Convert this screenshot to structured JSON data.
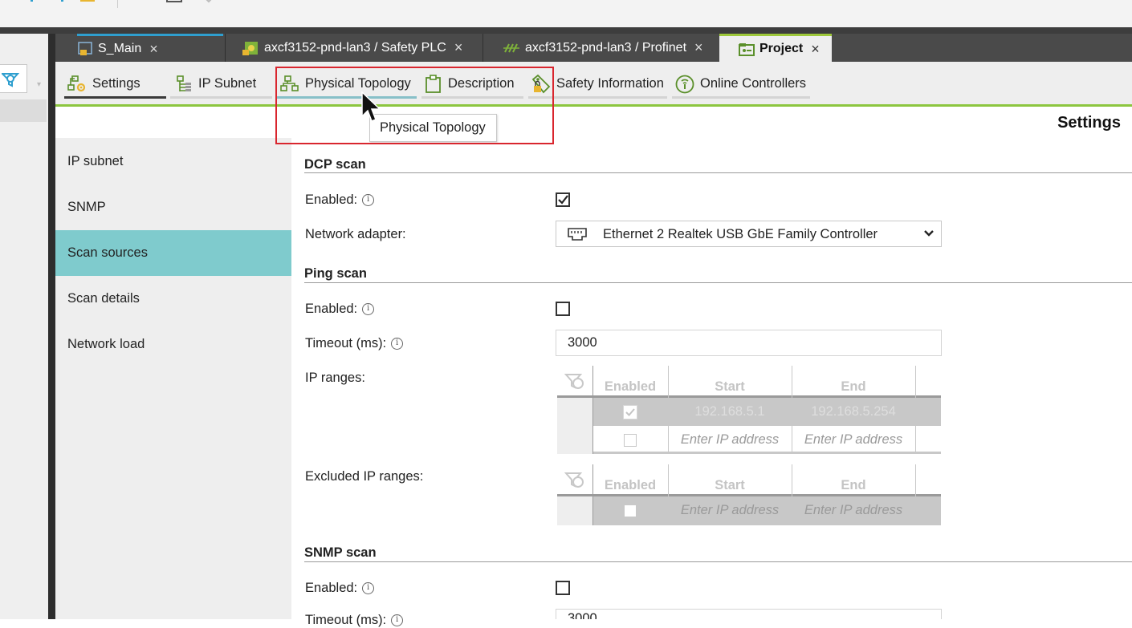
{
  "editor_tabs": [
    {
      "label": "S_Main",
      "close": "×"
    },
    {
      "label": "axcf3152-pnd-lan3 / Safety PLC",
      "close": "×"
    },
    {
      "label": "axcf3152-pnd-lan3 / Profinet",
      "close": "×"
    },
    {
      "label": "Project",
      "close": "×",
      "active": true
    }
  ],
  "sub_tabs": [
    {
      "label": "Settings",
      "active": true
    },
    {
      "label": "IP Subnet"
    },
    {
      "label": "Physical Topology",
      "hover": true
    },
    {
      "label": "Description"
    },
    {
      "label": "Safety Information"
    },
    {
      "label": "Online Controllers"
    }
  ],
  "tooltip": "Physical Topology",
  "page_title": "Settings",
  "nav": [
    {
      "label": "IP subnet"
    },
    {
      "label": "SNMP"
    },
    {
      "label": "Scan sources",
      "selected": true
    },
    {
      "label": "Scan details"
    },
    {
      "label": "Network load"
    }
  ],
  "dcp": {
    "title": "DCP scan",
    "enabled_label": "Enabled:",
    "enabled": true,
    "adapter_label": "Network adapter:",
    "adapter_value": "Ethernet 2 Realtek USB GbE Family Controller"
  },
  "ping": {
    "title": "Ping scan",
    "enabled_label": "Enabled:",
    "enabled": false,
    "timeout_label": "Timeout (ms):",
    "timeout_value": "3000",
    "ip_ranges_label": "IP ranges:",
    "excluded_label": "Excluded IP ranges:",
    "table_headers": [
      "Enabled",
      "Start",
      "End"
    ],
    "ip_ranges": [
      {
        "enabled": true,
        "start": "192.168.5.1",
        "end": "192.168.5.254",
        "selected": true
      },
      {
        "enabled": false,
        "start": "Enter IP address",
        "end": "Enter IP address",
        "placeholder": true
      }
    ],
    "excluded_ranges": [
      {
        "enabled": false,
        "start": "Enter IP address",
        "end": "Enter IP address",
        "placeholder": true,
        "selected": true
      }
    ]
  },
  "snmp": {
    "title": "SNMP scan",
    "enabled_label": "Enabled:",
    "enabled": false,
    "timeout_label": "Timeout (ms):",
    "timeout_value": "3000"
  },
  "colors": {
    "accent_green": "#8cc63f",
    "nav_selected": "#7fcbcd",
    "highlight_red": "#d9262e",
    "tab_bar": "#4a4a4a"
  }
}
